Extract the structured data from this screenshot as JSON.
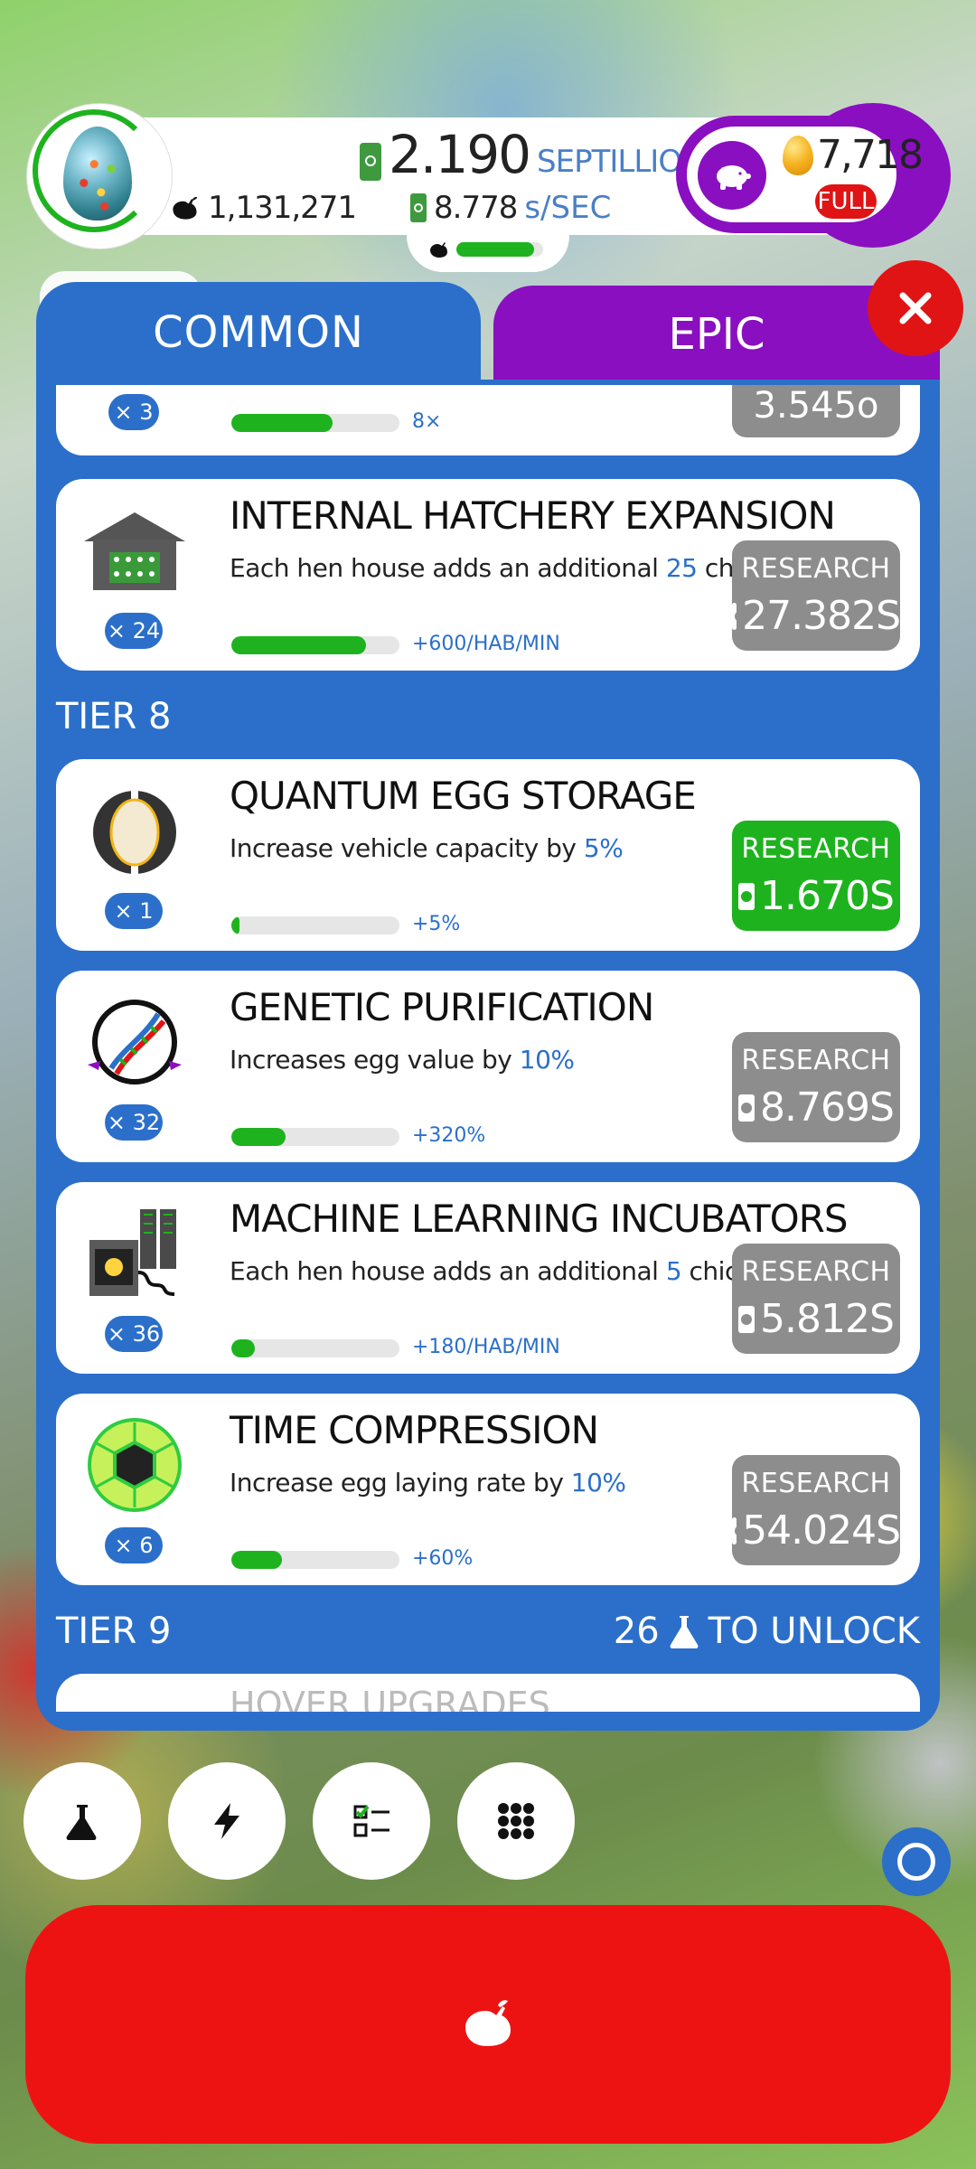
{
  "header": {
    "chicken_count": "1,131,271",
    "cash_value": "2.190",
    "cash_unit": "SEPTILLION",
    "rate_value": "8.778",
    "rate_unit": "s/SEC",
    "hab_progress": 0.9,
    "golden_eggs": "7,718",
    "piggy_status": "FULL"
  },
  "tabs": {
    "common": "COMMON",
    "epic": "EPIC"
  },
  "partial_top_card": {
    "level": "× 3",
    "effect": "8×",
    "cost": "3.545o",
    "progress": 0.6
  },
  "research": [
    {
      "title": "INTERNAL HATCHERY EXPANSION",
      "desc_pre": "Each hen house adds an additional ",
      "desc_hl": "25",
      "desc_post": " chickens/min",
      "level": "× 24",
      "progress": 0.8,
      "effect": "+600/HAB/MIN",
      "button_label": "RESEARCH",
      "cost": "27.382S",
      "affordable": false,
      "icon": "hen-house-icon"
    },
    {
      "title": "QUANTUM EGG STORAGE",
      "desc_pre": "Increase vehicle capacity by ",
      "desc_hl": "5%",
      "desc_post": "",
      "level": "× 1",
      "progress": 0.05,
      "effect": "+5%",
      "button_label": "RESEARCH",
      "cost": "1.670S",
      "affordable": true,
      "icon": "quantum-egg-icon"
    },
    {
      "title": "GENETIC PURIFICATION",
      "desc_pre": "Increases egg value by ",
      "desc_hl": "10%",
      "desc_post": "",
      "level": "× 32",
      "progress": 0.32,
      "effect": "+320%",
      "button_label": "RESEARCH",
      "cost": "8.769S",
      "affordable": false,
      "icon": "dna-icon"
    },
    {
      "title": "MACHINE LEARNING INCUBATORS",
      "desc_pre": "Each hen house adds an additional ",
      "desc_hl": "5",
      "desc_post": " chickens/min",
      "level": "× 36",
      "progress": 0.14,
      "effect": "+180/HAB/MIN",
      "button_label": "RESEARCH",
      "cost": "5.812S",
      "affordable": false,
      "icon": "incubator-icon"
    },
    {
      "title": "TIME COMPRESSION",
      "desc_pre": "Increase egg laying rate by ",
      "desc_hl": "10%",
      "desc_post": "",
      "level": "× 6",
      "progress": 0.3,
      "effect": "+60%",
      "button_label": "RESEARCH",
      "cost": "54.024S",
      "affordable": false,
      "icon": "time-sphere-icon"
    }
  ],
  "tiers": {
    "tier8": "TIER 8",
    "tier9": "TIER 9",
    "tier9_unlock_count": "26",
    "tier9_unlock_text": "TO UNLOCK"
  },
  "partial_bottom_title": "HOVER UPGRADES",
  "colors": {
    "panel_blue": "#2b6fca",
    "epic_purple": "#8a0fc0",
    "research_green": "#1eb31e",
    "disabled_gray": "#8d8d8d",
    "alert_red": "#ee1313"
  },
  "bottom_nav": {
    "icons": [
      "flask-icon",
      "lightning-icon",
      "checklist-icon",
      "grid-icon"
    ]
  }
}
